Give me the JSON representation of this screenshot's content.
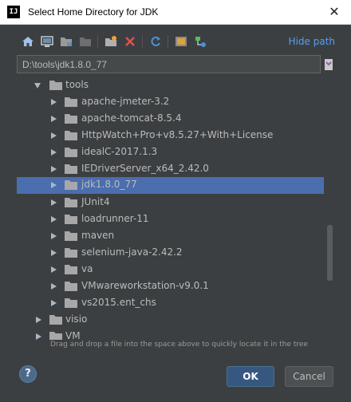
{
  "window": {
    "title": "Select Home Directory for JDK",
    "app_icon": "IJ",
    "close_icon": "close-icon"
  },
  "toolbar": {
    "icons": [
      "home-icon",
      "desktop-icon",
      "project-folder-icon",
      "module-folder-icon",
      "new-folder-icon",
      "delete-icon",
      "refresh-icon",
      "show-hidden-icon",
      "collapse-icon"
    ],
    "hide_path": "Hide path"
  },
  "path": {
    "value": "D:\\tools\\jdk1.8.0_77"
  },
  "tree": {
    "items": [
      {
        "label": "tools",
        "expanded": true,
        "level": 1
      },
      {
        "label": "apache-jmeter-3.2",
        "level": 2
      },
      {
        "label": "apache-tomcat-8.5.4",
        "level": 2
      },
      {
        "label": "HttpWatch+Pro+v8.5.27+With+License",
        "level": 2
      },
      {
        "label": "idealC-2017.1.3",
        "level": 2
      },
      {
        "label": "IEDriverServer_x64_2.42.0",
        "level": 2
      },
      {
        "label": "jdk1.8.0_77",
        "level": 2,
        "selected": true
      },
      {
        "label": "JUnit4",
        "level": 2
      },
      {
        "label": "loadrunner-11",
        "level": 2
      },
      {
        "label": "maven",
        "level": 2
      },
      {
        "label": "selenium-java-2.42.2",
        "level": 2
      },
      {
        "label": "va",
        "level": 2
      },
      {
        "label": "VMwareworkstation-v9.0.1",
        "level": 2
      },
      {
        "label": "vs2015.ent_chs",
        "level": 2
      },
      {
        "label": "visio",
        "level": 1
      },
      {
        "label": "VM",
        "level": 1
      }
    ]
  },
  "hint": "Drag and drop a file into the space above to quickly locate it in the tree",
  "buttons": {
    "help": "?",
    "ok": "OK",
    "cancel": "Cancel"
  },
  "colors": {
    "background": "#3c3f41",
    "selection": "#4b6eaf",
    "link": "#589df6",
    "ok_button": "#365880"
  }
}
